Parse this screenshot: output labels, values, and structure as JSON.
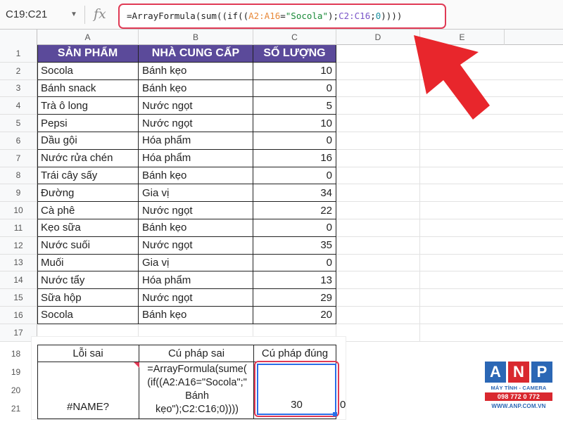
{
  "formula_bar": {
    "name_box": "C19:C21",
    "fx": "fx",
    "formula_parts": [
      {
        "text": "=ArrayFormula(sum((if((",
        "color": "default"
      },
      {
        "text": "A2:A16",
        "color": "orange"
      },
      {
        "text": "=",
        "color": "default"
      },
      {
        "text": "\"Socola\"",
        "color": "green"
      },
      {
        "text": ");",
        "color": "default"
      },
      {
        "text": "C2:C16",
        "color": "purple"
      },
      {
        "text": ";",
        "color": "default"
      },
      {
        "text": "0",
        "color": "teal"
      },
      {
        "text": "))))",
        "color": "default"
      }
    ]
  },
  "columns": [
    "A",
    "B",
    "C",
    "D",
    "E"
  ],
  "table": {
    "headers": [
      "SẢN PHẨM",
      "NHÀ CUNG CẤP",
      "SỐ LƯỢNG"
    ],
    "rows": [
      [
        "Socola",
        "Bánh kẹo",
        "10"
      ],
      [
        "Bánh snack",
        "Bánh kẹo",
        "0"
      ],
      [
        "Trà ô long",
        "Nước ngọt",
        "5"
      ],
      [
        "Pepsi",
        "Nước ngọt",
        "10"
      ],
      [
        "Dầu gội",
        "Hóa phẩm",
        "0"
      ],
      [
        "Nước rửa chén",
        "Hóa phẩm",
        "16"
      ],
      [
        "Trái cây sấy",
        "Bánh kẹo",
        "0"
      ],
      [
        "Đường",
        "Gia vị",
        "34"
      ],
      [
        "Cà phê",
        "Nước ngọt",
        "22"
      ],
      [
        "Kẹo sữa",
        "Bánh kẹo",
        "0"
      ],
      [
        "Nước suối",
        "Nước ngọt",
        "35"
      ],
      [
        "Muối",
        "Gia vị",
        "0"
      ],
      [
        "Nước tẩy",
        "Hóa phẩm",
        "13"
      ],
      [
        "Sữa hộp",
        "Nước ngọt",
        "29"
      ],
      [
        "Socola",
        "Bánh kẹo",
        "20"
      ]
    ]
  },
  "row_numbers": [
    "1",
    "2",
    "3",
    "4",
    "5",
    "6",
    "7",
    "8",
    "9",
    "10",
    "11",
    "12",
    "13",
    "14",
    "15",
    "16",
    "17",
    "18",
    "19",
    "20",
    "21"
  ],
  "bottom_table": {
    "headers": [
      "Lỗi sai",
      "Cú pháp sai",
      "Cú pháp đúng"
    ],
    "error_value": "#NAME?",
    "wrong_syntax": "=ArrayFormula(sume(\n(if((A2:A16=\"Socola\";\"\nBánh\nkẹo\");C2:C16;0))))",
    "correct_value": "30",
    "overflow_digit": "0"
  },
  "logo": {
    "letters": [
      "A",
      "N",
      "P"
    ],
    "tagline": "MÁY TÍNH - CAMERA",
    "phone": "098 772 0 772",
    "url": "WWW.ANP.COM.VN"
  },
  "colors": {
    "header_bg": "#5b4a9a",
    "highlight_red": "#e03a55",
    "selection_blue": "#2a6ee8",
    "arrow_red": "#e8262c",
    "logo_blue": "#2b67b5",
    "logo_red": "#d9282f"
  }
}
